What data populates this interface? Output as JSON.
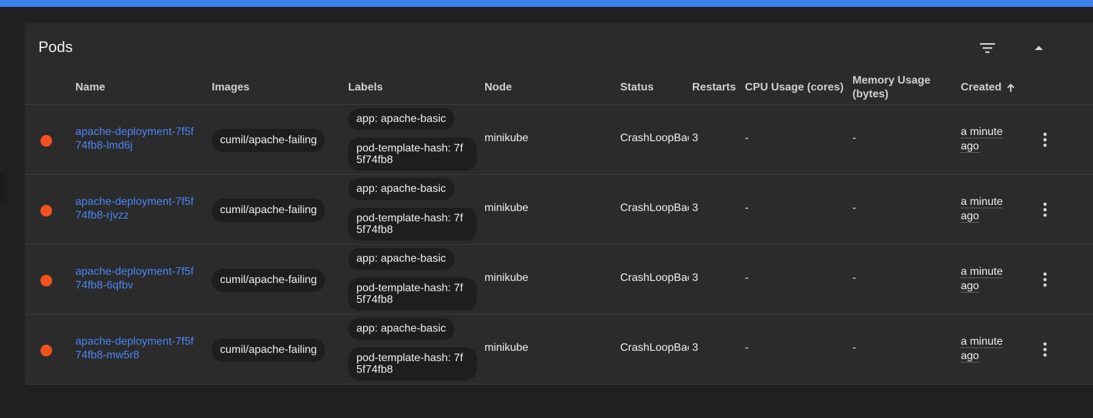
{
  "panel": {
    "title": "Pods",
    "filter_icon": "filter-list-icon",
    "collapse_icon": "chevron-up-icon"
  },
  "columns": {
    "name": "Name",
    "images": "Images",
    "labels": "Labels",
    "node": "Node",
    "status": "Status",
    "restarts": "Restarts",
    "cpu": "CPU Usage (cores)",
    "memory_line1": "Memory Usage",
    "memory_line2": "(bytes)",
    "created": "Created",
    "created_sort_icon": "arrow-up-icon"
  },
  "rows": [
    {
      "status_color": "#f4511e",
      "name": "apache-deployment-7f5f74fb8-lmd6j",
      "image": "cumil/apache-failing",
      "label1": "app: apache-basic",
      "label2": "pod-template-hash: 7f5f74fb8",
      "node": "minikube",
      "status": "CrashLoopBackOff",
      "restarts": "3",
      "cpu": "-",
      "memory": "-",
      "created": "a minute ago"
    },
    {
      "status_color": "#f4511e",
      "name": "apache-deployment-7f5f74fb8-rjvzz",
      "image": "cumil/apache-failing",
      "label1": "app: apache-basic",
      "label2": "pod-template-hash: 7f5f74fb8",
      "node": "minikube",
      "status": "CrashLoopBackOff",
      "restarts": "3",
      "cpu": "-",
      "memory": "-",
      "created": "a minute ago"
    },
    {
      "status_color": "#f4511e",
      "name": "apache-deployment-7f5f74fb8-6qfbv",
      "image": "cumil/apache-failing",
      "label1": "app: apache-basic",
      "label2": "pod-template-hash: 7f5f74fb8",
      "node": "minikube",
      "status": "CrashLoopBackOff",
      "restarts": "3",
      "cpu": "-",
      "memory": "-",
      "created": "a minute ago"
    },
    {
      "status_color": "#f4511e",
      "name": "apache-deployment-7f5f74fb8-mw5r8",
      "image": "cumil/apache-failing",
      "label1": "app: apache-basic",
      "label2": "pod-template-hash: 7f5f74fb8",
      "node": "minikube",
      "status": "CrashLoopBackOff",
      "restarts": "3",
      "cpu": "-",
      "memory": "-",
      "created": "a minute ago"
    }
  ],
  "row_more_icon": "more-vert-icon",
  "colors": {
    "accent": "#3c7fef",
    "link": "#4a86f7",
    "error": "#f4511e"
  }
}
